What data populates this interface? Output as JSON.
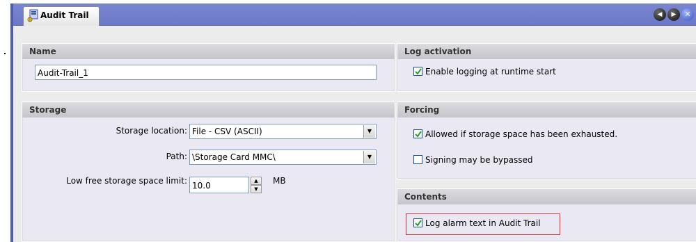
{
  "window": {
    "tab_label": "Audit Trail",
    "nav_icons": [
      "previous-arrow-icon",
      "next-arrow-icon",
      "close-icon"
    ]
  },
  "name_panel": {
    "header": "Name",
    "value": "Audit-Trail_1"
  },
  "storage_panel": {
    "header": "Storage",
    "location_label": "Storage location:",
    "location_value": "File - CSV (ASCII)",
    "path_label": "Path:",
    "path_value": "\\Storage Card MMC\\",
    "limit_label": "Low free storage space limit:",
    "limit_value": "10.0",
    "limit_unit": "MB"
  },
  "log_activation_panel": {
    "header": "Log activation",
    "enable_label": "Enable logging at runtime start",
    "enable_checked": true
  },
  "forcing_panel": {
    "header": "Forcing",
    "allowed_label": "Allowed if storage space has been exhausted.",
    "allowed_checked": true,
    "signing_label": "Signing may be bypassed",
    "signing_checked": false
  },
  "contents_panel": {
    "header": "Contents",
    "log_alarm_label": "Log alarm text in Audit Trail",
    "log_alarm_checked": true
  },
  "colors": {
    "tabstrip": "#6a78c7",
    "highlight": "#e0282c",
    "panel_bg": "#eae8f2"
  }
}
